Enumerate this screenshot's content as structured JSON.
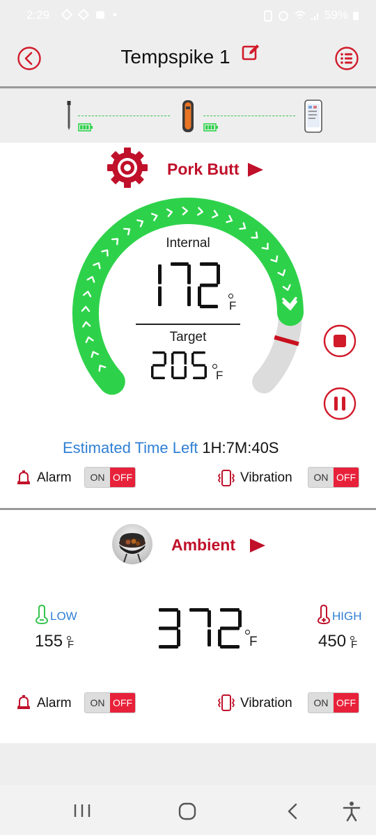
{
  "status": {
    "time": "2:29",
    "battery": "59%"
  },
  "header": {
    "title": "Tempspike 1"
  },
  "probe": {
    "name": "Pork Butt",
    "internal_label": "Internal",
    "internal_temp": "172",
    "target_label": "Target",
    "target_temp": "205",
    "unit": "F",
    "progress_fraction": 0.84,
    "target_marker_fraction": 0.9,
    "est_label": "Estimated Time Left",
    "est_value": "1H:7M:40S",
    "alarm_label": "Alarm",
    "vibration_label": "Vibration",
    "toggle_on": "ON",
    "toggle_off": "OFF"
  },
  "ambient": {
    "name": "Ambient",
    "temp": "372",
    "unit": "F",
    "low_label": "LOW",
    "low_value": "155",
    "high_label": "HIGH",
    "high_value": "450",
    "alarm_label": "Alarm",
    "vibration_label": "Vibration",
    "toggle_on": "ON",
    "toggle_off": "OFF"
  },
  "colors": {
    "accent_red": "#c0102a",
    "progress_green": "#2ed24a",
    "link_blue": "#2f7fd4",
    "toggle_red": "#e8213a"
  },
  "icons": [
    "back-icon",
    "edit-icon",
    "menu-icon",
    "probe-icon",
    "battery-icon",
    "repeater-icon",
    "phone-icon",
    "gear-icon",
    "play-icon",
    "stop-icon",
    "pause-icon",
    "bell-icon",
    "vibration-icon",
    "thermometer-low-icon",
    "thermometer-high-icon",
    "grill-icon"
  ]
}
